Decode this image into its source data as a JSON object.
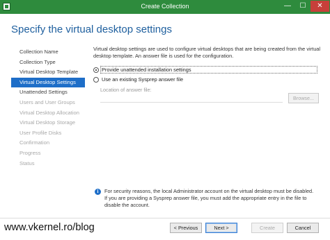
{
  "window": {
    "title": "Create Collection",
    "controls": {
      "minimize": "—",
      "maximize": "☐",
      "close": "✕"
    }
  },
  "page": {
    "title": "Specify the virtual desktop settings"
  },
  "steps": [
    {
      "label": "Collection Name",
      "state": "normal"
    },
    {
      "label": "Collection Type",
      "state": "normal"
    },
    {
      "label": "Virtual Desktop Template",
      "state": "normal"
    },
    {
      "label": "Virtual Desktop Settings",
      "state": "active"
    },
    {
      "label": "Unattended Settings",
      "state": "normal"
    },
    {
      "label": "Users and User Groups",
      "state": "disabled"
    },
    {
      "label": "Virtual Desktop Allocation",
      "state": "disabled"
    },
    {
      "label": "Virtual Desktop Storage",
      "state": "disabled"
    },
    {
      "label": "User Profile Disks",
      "state": "disabled"
    },
    {
      "label": "Confirmation",
      "state": "disabled"
    },
    {
      "label": "Progress",
      "state": "disabled"
    },
    {
      "label": "Status",
      "state": "disabled"
    }
  ],
  "content": {
    "intro": "Virtual desktop settings are used to configure virtual desktops that are being created from the virtual desktop template. An answer file is used for the configuration.",
    "option_unattended": "Provide unattended installation settings",
    "option_sysprep": "Use an existing Sysprep answer file",
    "answer_file_label": "Location of answer file:",
    "answer_file_value": "",
    "browse_label": "Browse...",
    "selected_option": "unattended"
  },
  "info": {
    "text": "For security reasons, the local Administrator account on the virtual desktop must be disabled. If you are providing a Sysprep answer file, you must add the appropriate entry in the file to disable the account."
  },
  "footer": {
    "watermark": "www.vkernel.ro/blog",
    "previous_label": "< Previous",
    "next_label": "Next >",
    "create_label": "Create",
    "cancel_label": "Cancel"
  },
  "colors": {
    "titlebar": "#2e8b3d",
    "accent": "#1e6ec8",
    "page_title": "#1e5f9e",
    "close_button": "#c7403a"
  }
}
